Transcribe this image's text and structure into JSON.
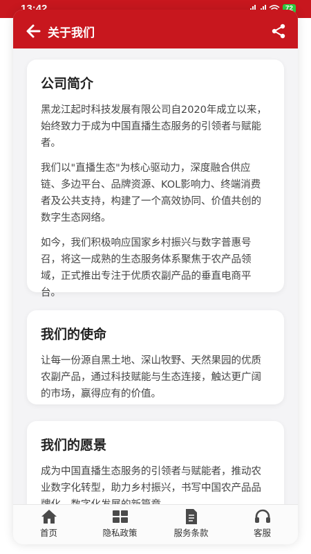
{
  "status_bar": {
    "time": "13:42",
    "network": "5G",
    "battery": "72"
  },
  "header": {
    "title": "关于我们",
    "back_icon": "arrow-left-icon",
    "share_icon": "share-icon"
  },
  "sections": [
    {
      "title": "公司简介",
      "paragraphs": [
        "黑龙江起时科技发展有限公司自2020年成立以来，始终致力于成为中国直播生态服务的引领者与赋能者。",
        "我们以\"直播生态\"为核心驱动力，深度融合供应链、多边平台、品牌资源、KOL影响力、终端消费者及公共支持，构建了一个高效协同、价值共创的数字生态网络。",
        "如今，我们积极响应国家乡村振兴与数字普惠号召，将这一成熟的生态服务体系聚焦于农产品领域，正式推出专注于优质农副产品的垂直电商平台。"
      ]
    },
    {
      "title": "我们的使命",
      "paragraphs": [
        "让每一份源自黑土地、深山牧野、天然果园的优质农副产品，通过科技赋能与生态连接，触达更广阔的市场，赢得应有的价值。"
      ]
    },
    {
      "title": "我们的愿景",
      "paragraphs": [
        "成为中国直播生态服务的引领者与赋能者，推动农业数字化转型，助力乡村振兴，书写中国农产品品牌化、数字化发展的新篇章。"
      ]
    }
  ],
  "tabbar": [
    {
      "label": "首页",
      "icon": "home-icon"
    },
    {
      "label": "隐私政策",
      "icon": "grid-icon"
    },
    {
      "label": "服务条款",
      "icon": "document-icon"
    },
    {
      "label": "客服",
      "icon": "headset-icon"
    }
  ],
  "colors": {
    "accent": "#c8171e",
    "page_bg": "#f4f4f6"
  }
}
